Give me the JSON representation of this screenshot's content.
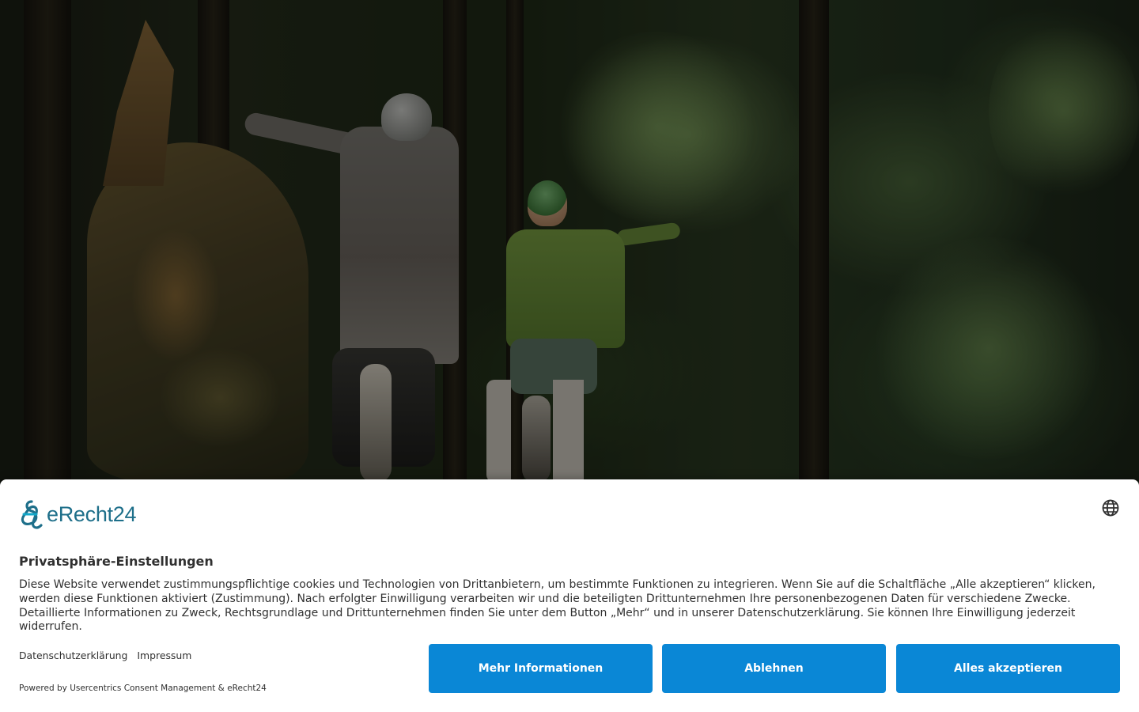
{
  "brand": {
    "name": "eRecht24",
    "color": "#1e6f8a"
  },
  "banner": {
    "title": "Privatsphäre-Einstellungen",
    "description": "Diese Website verwendet zustimmungspflichtige cookies und Technologien von Drittanbietern, um bestimmte Funktionen zu integrieren. Wenn Sie auf die Schaltfläche „Alle akzeptieren“ klicken, werden diese Funktionen aktiviert (Zustimmung). Nach erfolgter Einwilligung verarbeiten wir und die beteiligten Drittunternehmen Ihre personenbezogenen Daten für verschiedene Zwecke. Detaillierte Informationen zu Zweck, Rechtsgrundlage und Drittunternehmen finden Sie unter dem Button „Mehr“ und in unserer Datenschutzerklärung. Sie können Ihre Einwilligung jederzeit widerrufen.",
    "links": {
      "privacy": "Datenschutzerklärung",
      "imprint": "Impressum"
    },
    "powered_by": "Powered by Usercentrics Consent Management & eRecht24",
    "language_icon": "globe-icon",
    "buttons": {
      "more_info": "Mehr Informationen",
      "decline": "Ablehnen",
      "accept_all": "Alles akzeptieren"
    },
    "accent_color": "#0a87d6"
  },
  "background": {
    "image": "forest-mountain-bikers"
  }
}
